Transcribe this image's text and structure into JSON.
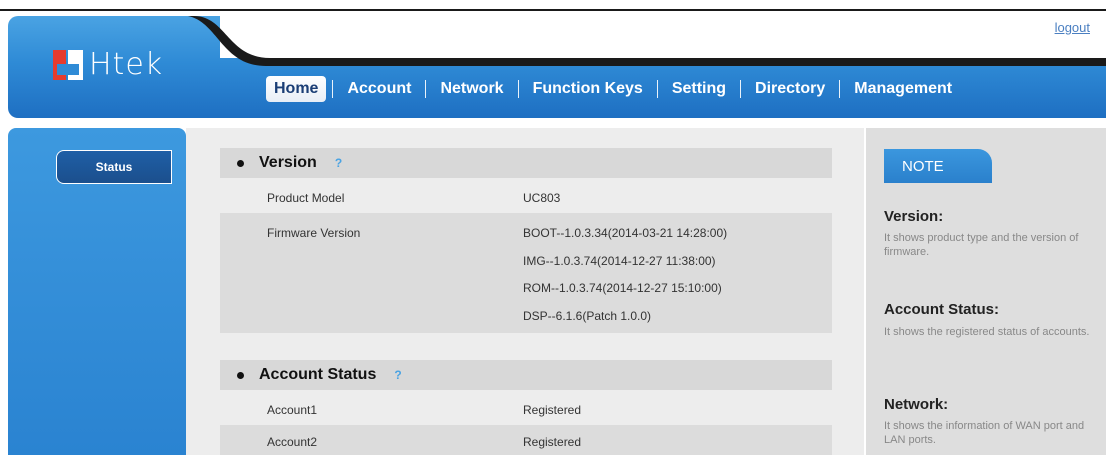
{
  "header": {
    "logout": "logout",
    "brand": "Htek",
    "nav": [
      "Home",
      "Account",
      "Network",
      "Function Keys",
      "Setting",
      "Directory",
      "Management"
    ]
  },
  "sidebar": {
    "items": [
      "Status"
    ]
  },
  "version": {
    "title": "Version",
    "help": "?",
    "rows": [
      {
        "label": "Product Model",
        "value": "UC803"
      },
      {
        "label": "Firmware Version",
        "value": "BOOT--1.0.3.34(2014-03-21 14:28:00)"
      },
      {
        "label": "",
        "value": "IMG--1.0.3.74(2014-12-27 11:38:00)"
      },
      {
        "label": "",
        "value": "ROM--1.0.3.74(2014-12-27 15:10:00)"
      },
      {
        "label": "",
        "value": "DSP--6.1.6(Patch 1.0.0)"
      }
    ]
  },
  "account_status": {
    "title": "Account Status",
    "help": "?",
    "rows": [
      {
        "label": "Account1",
        "value": "Registered"
      },
      {
        "label": "Account2",
        "value": "Registered"
      }
    ]
  },
  "note": {
    "tab": "NOTE",
    "items": [
      {
        "title": "Version:",
        "text": "It shows product type and the version of firmware."
      },
      {
        "title": "Account Status:",
        "text": "It shows the registered status of accounts."
      },
      {
        "title": "Network:",
        "text": "It shows the information of WAN port and LAN ports."
      }
    ]
  },
  "colors": {
    "header_blue": "#2f8bd6",
    "logo_red": "#e63b2e",
    "link": "#4a7fc1"
  }
}
